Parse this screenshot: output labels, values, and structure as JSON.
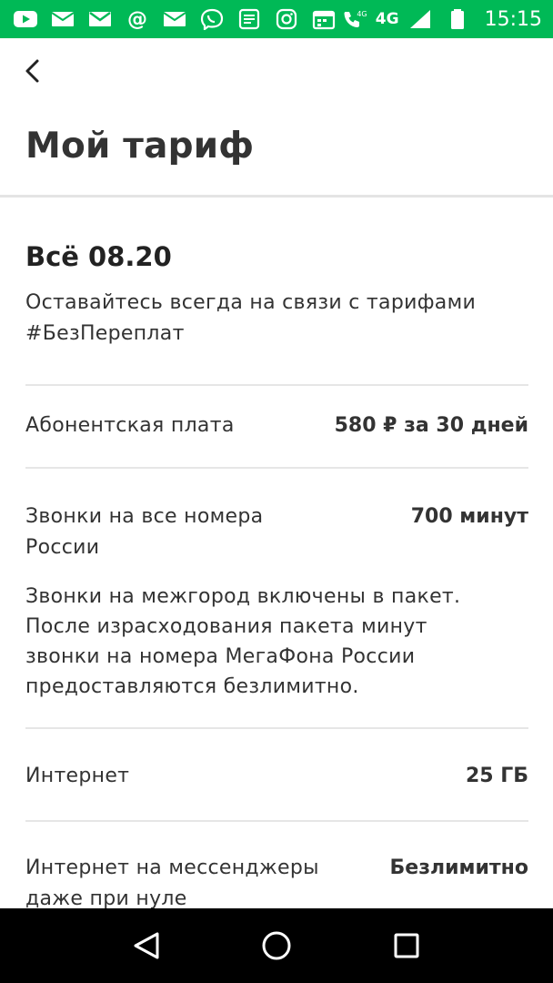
{
  "status_bar": {
    "time": "15:15",
    "network_label_small": "4G",
    "network_label": "4G",
    "icons": [
      "youtube-icon",
      "mail-icon",
      "gmail-icon",
      "at-icon",
      "mail-icon",
      "viber-icon",
      "news-icon",
      "instagram-icon",
      "calendar-icon"
    ],
    "color": "#00b956"
  },
  "header": {
    "back_icon": "chevron-left-icon",
    "title": "Мой тариф"
  },
  "tariff": {
    "name": "Всё 08.20",
    "description": "Оставайтесь всегда на связи с тарифами #БезПереплат"
  },
  "rows": [
    {
      "label": "Абонентская плата",
      "value": "580 ₽ за 30 дней"
    },
    {
      "label": "Звонки на все номера России",
      "value": "700 минут",
      "note": "Звонки на межгород включены в пакет. После израсходования пакета минут звонки на номера МегаФона России предоставляются безлимитно."
    },
    {
      "label": "Интернет",
      "value": "25 ГБ"
    },
    {
      "label": "Интернет на мессенджеры даже при нуле",
      "value": "Безлимитно"
    }
  ],
  "nav_bar": {
    "back_icon": "triangle-back-icon",
    "home_icon": "circle-home-icon",
    "recents_icon": "square-recents-icon"
  }
}
